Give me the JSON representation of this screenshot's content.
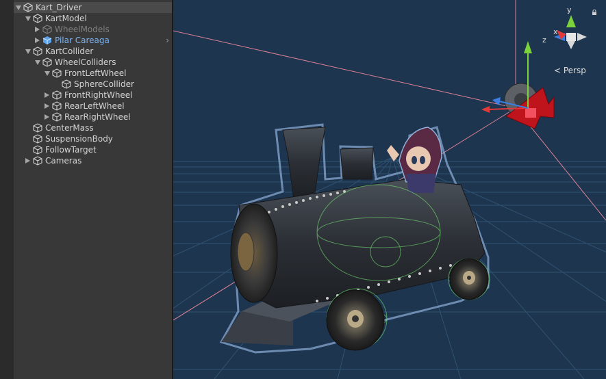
{
  "hierarchy": {
    "items": [
      {
        "label": "Kart_Driver",
        "depth": 0,
        "arrow": "down",
        "style": "normal",
        "icon": "cube-icon"
      },
      {
        "label": "KartModel",
        "depth": 1,
        "arrow": "down",
        "style": "normal",
        "icon": "cube-icon"
      },
      {
        "label": "WheelModels",
        "depth": 2,
        "arrow": "right",
        "style": "dim",
        "icon": "cube-icon"
      },
      {
        "label": "Pilar Careaga",
        "depth": 2,
        "arrow": "right",
        "style": "prefab",
        "icon": "prefab-cube-icon",
        "chevron": "›"
      },
      {
        "label": "KartCollider",
        "depth": 1,
        "arrow": "down",
        "style": "normal",
        "icon": "cube-icon"
      },
      {
        "label": "WheelColliders",
        "depth": 2,
        "arrow": "down",
        "style": "normal",
        "icon": "cube-icon"
      },
      {
        "label": "FrontLeftWheel",
        "depth": 3,
        "arrow": "down",
        "style": "normal",
        "icon": "cube-icon"
      },
      {
        "label": "SphereCollider",
        "depth": 4,
        "arrow": "none",
        "style": "normal",
        "icon": "cube-icon"
      },
      {
        "label": "FrontRightWheel",
        "depth": 3,
        "arrow": "right",
        "style": "normal",
        "icon": "cube-icon"
      },
      {
        "label": "RearLeftWheel",
        "depth": 3,
        "arrow": "right",
        "style": "normal",
        "icon": "cube-icon"
      },
      {
        "label": "RearRightWheel",
        "depth": 3,
        "arrow": "right",
        "style": "normal",
        "icon": "cube-icon"
      },
      {
        "label": "CenterMass",
        "depth": 1,
        "arrow": "none",
        "style": "normal",
        "icon": "cube-icon"
      },
      {
        "label": "SuspensionBody",
        "depth": 1,
        "arrow": "none",
        "style": "normal",
        "icon": "cube-icon"
      },
      {
        "label": "FollowTarget",
        "depth": 1,
        "arrow": "none",
        "style": "normal",
        "icon": "cube-icon"
      },
      {
        "label": "Cameras",
        "depth": 1,
        "arrow": "right",
        "style": "normal",
        "icon": "cube-icon"
      }
    ]
  },
  "scene": {
    "projection_label": "< Persp",
    "axis_labels": {
      "y": "y",
      "x": "x",
      "z": "z"
    },
    "colors": {
      "background": "#1e3550",
      "grid": "#3f6f92",
      "x_axis": "#e03a3a",
      "y_axis": "#7cd23a",
      "z_axis": "#3b7fe0",
      "selection_outline": "#8fb0d8",
      "collider": "#7cf07a",
      "camera_gizmo": "#c0141c"
    }
  }
}
